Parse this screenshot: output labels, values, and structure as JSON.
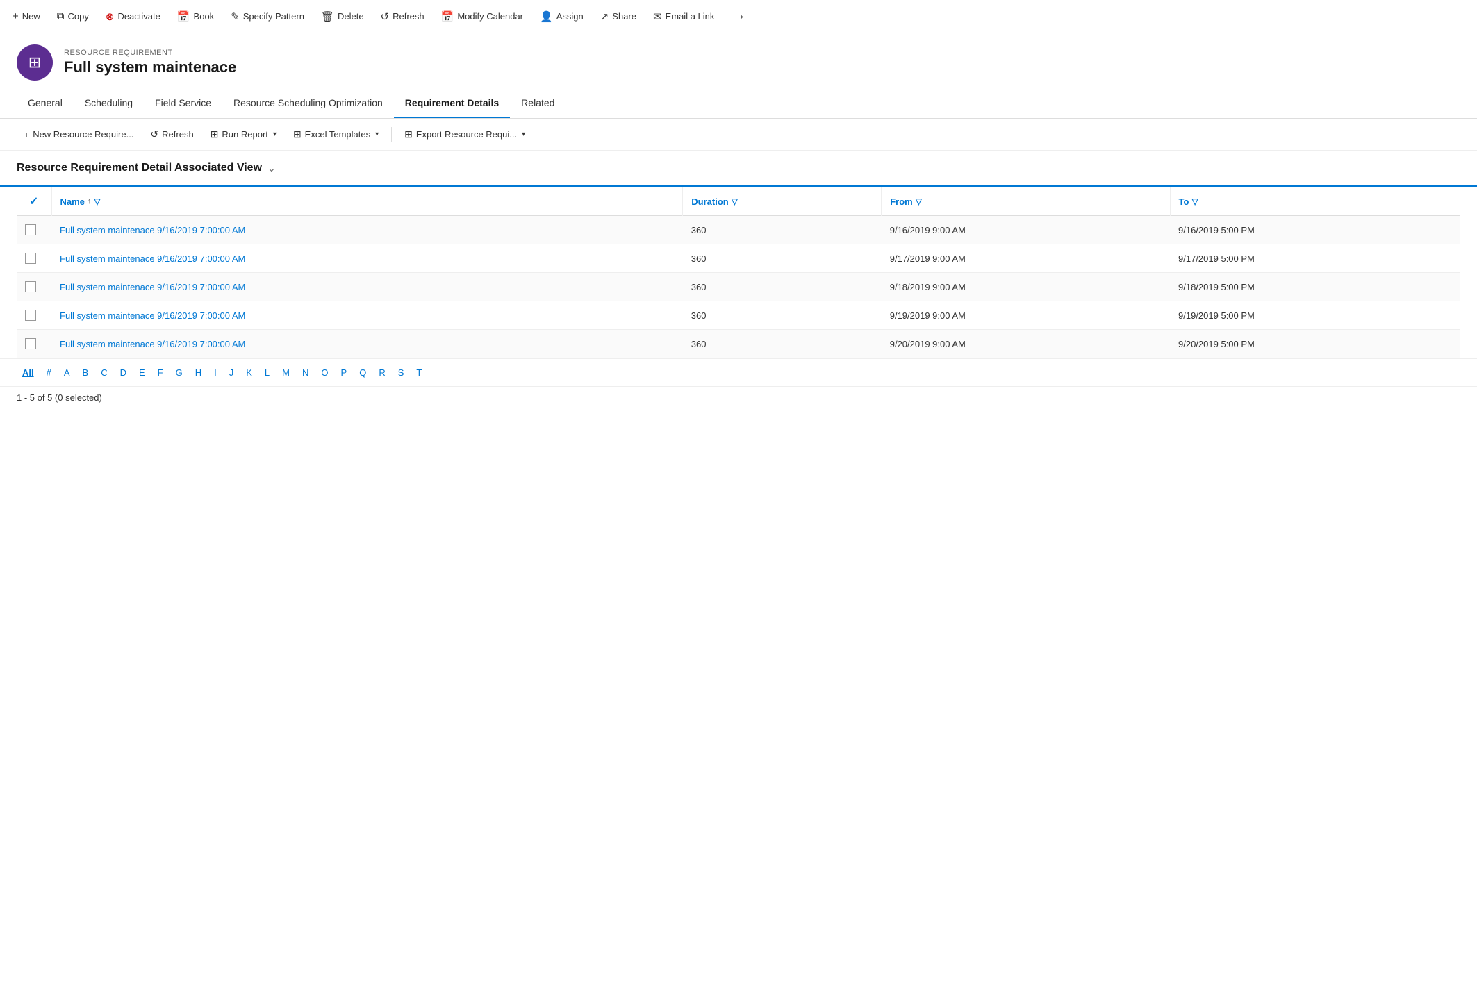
{
  "toolbar": {
    "buttons": [
      {
        "id": "new",
        "label": "New",
        "icon": "+"
      },
      {
        "id": "copy",
        "label": "Copy",
        "icon": "⧉"
      },
      {
        "id": "deactivate",
        "label": "Deactivate",
        "icon": "⊗"
      },
      {
        "id": "book",
        "label": "Book",
        "icon": "📅"
      },
      {
        "id": "specify-pattern",
        "label": "Specify Pattern",
        "icon": "✎"
      },
      {
        "id": "delete",
        "label": "Delete",
        "icon": "🗑"
      },
      {
        "id": "refresh",
        "label": "Refresh",
        "icon": "↺"
      },
      {
        "id": "modify-calendar",
        "label": "Modify Calendar",
        "icon": "📅"
      },
      {
        "id": "assign",
        "label": "Assign",
        "icon": "👤"
      },
      {
        "id": "share",
        "label": "Share",
        "icon": "↗"
      },
      {
        "id": "email-link",
        "label": "Email a Link",
        "icon": "✉"
      }
    ]
  },
  "record": {
    "type": "RESOURCE REQUIREMENT",
    "title": "Full system maintenace",
    "icon": "⊞"
  },
  "tabs": [
    {
      "id": "general",
      "label": "General",
      "active": false
    },
    {
      "id": "scheduling",
      "label": "Scheduling",
      "active": false
    },
    {
      "id": "field-service",
      "label": "Field Service",
      "active": false
    },
    {
      "id": "resource-scheduling",
      "label": "Resource Scheduling Optimization",
      "active": false
    },
    {
      "id": "requirement-details",
      "label": "Requirement Details",
      "active": true
    },
    {
      "id": "related",
      "label": "Related",
      "active": false
    }
  ],
  "subtoolbar": {
    "buttons": [
      {
        "id": "new-resource",
        "label": "New Resource Require...",
        "icon": "+"
      },
      {
        "id": "refresh",
        "label": "Refresh",
        "icon": "↺"
      },
      {
        "id": "run-report",
        "label": "Run Report",
        "icon": "📊",
        "dropdown": true
      },
      {
        "id": "excel-templates",
        "label": "Excel Templates",
        "icon": "⊞",
        "dropdown": true
      },
      {
        "id": "export",
        "label": "Export Resource Requi...",
        "icon": "⊞",
        "dropdown": true
      }
    ]
  },
  "view": {
    "title": "Resource Requirement Detail Associated View"
  },
  "table": {
    "columns": [
      {
        "id": "name",
        "label": "Name",
        "sortable": true,
        "filterable": true
      },
      {
        "id": "duration",
        "label": "Duration",
        "filterable": true
      },
      {
        "id": "from",
        "label": "From",
        "filterable": true
      },
      {
        "id": "to",
        "label": "To",
        "filterable": true
      }
    ],
    "rows": [
      {
        "name": "Full system maintenace 9/16/2019 7:00:00 AM",
        "duration": "360",
        "from": "9/16/2019 9:00 AM",
        "to": "9/16/2019 5:00 PM"
      },
      {
        "name": "Full system maintenace 9/16/2019 7:00:00 AM",
        "duration": "360",
        "from": "9/17/2019 9:00 AM",
        "to": "9/17/2019 5:00 PM"
      },
      {
        "name": "Full system maintenace 9/16/2019 7:00:00 AM",
        "duration": "360",
        "from": "9/18/2019 9:00 AM",
        "to": "9/18/2019 5:00 PM"
      },
      {
        "name": "Full system maintenace 9/16/2019 7:00:00 AM",
        "duration": "360",
        "from": "9/19/2019 9:00 AM",
        "to": "9/19/2019 5:00 PM"
      },
      {
        "name": "Full system maintenace 9/16/2019 7:00:00 AM",
        "duration": "360",
        "from": "9/20/2019 9:00 AM",
        "to": "9/20/2019 5:00 PM"
      }
    ]
  },
  "pagination": {
    "letters": [
      "All",
      "#",
      "A",
      "B",
      "C",
      "D",
      "E",
      "F",
      "G",
      "H",
      "I",
      "J",
      "K",
      "L",
      "M",
      "N",
      "O",
      "P",
      "Q",
      "R",
      "S",
      "T"
    ],
    "active": "All"
  },
  "record_count": "1 - 5 of 5 (0 selected)"
}
